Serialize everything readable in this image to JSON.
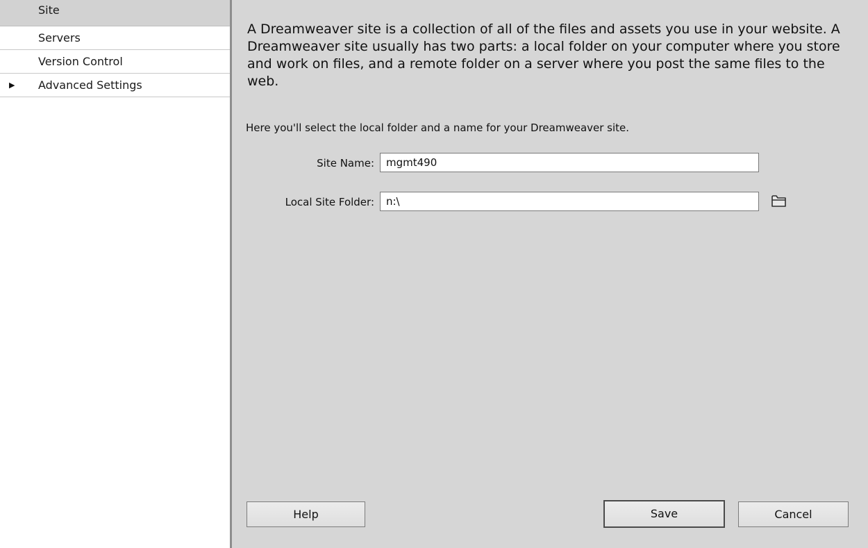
{
  "sidebar": {
    "items": [
      {
        "label": "Site",
        "selected": true
      },
      {
        "label": "Servers"
      },
      {
        "label": "Version Control"
      },
      {
        "label": "Advanced Settings",
        "expandable": true
      }
    ]
  },
  "main": {
    "intro": "A Dreamweaver site is a collection of all of the files and assets you use in your website. A Dreamweaver site usually has two parts: a local folder on your computer where you store and work on files, and a remote folder on a server where you post the same files to the web.",
    "instruction": "Here you'll select the local folder and a name for your Dreamweaver site.",
    "site_name_label": "Site Name:",
    "site_name_value": "mgmt490",
    "local_folder_label": "Local Site Folder:",
    "local_folder_value": "n:\\",
    "folder_icon": "folder-icon"
  },
  "buttons": {
    "help": "Help",
    "save": "Save",
    "cancel": "Cancel"
  },
  "colors": {
    "content_bg": "#d6d6d6",
    "selected_item_bg": "#d2d2d2",
    "splitter": "#8e8e8e"
  }
}
